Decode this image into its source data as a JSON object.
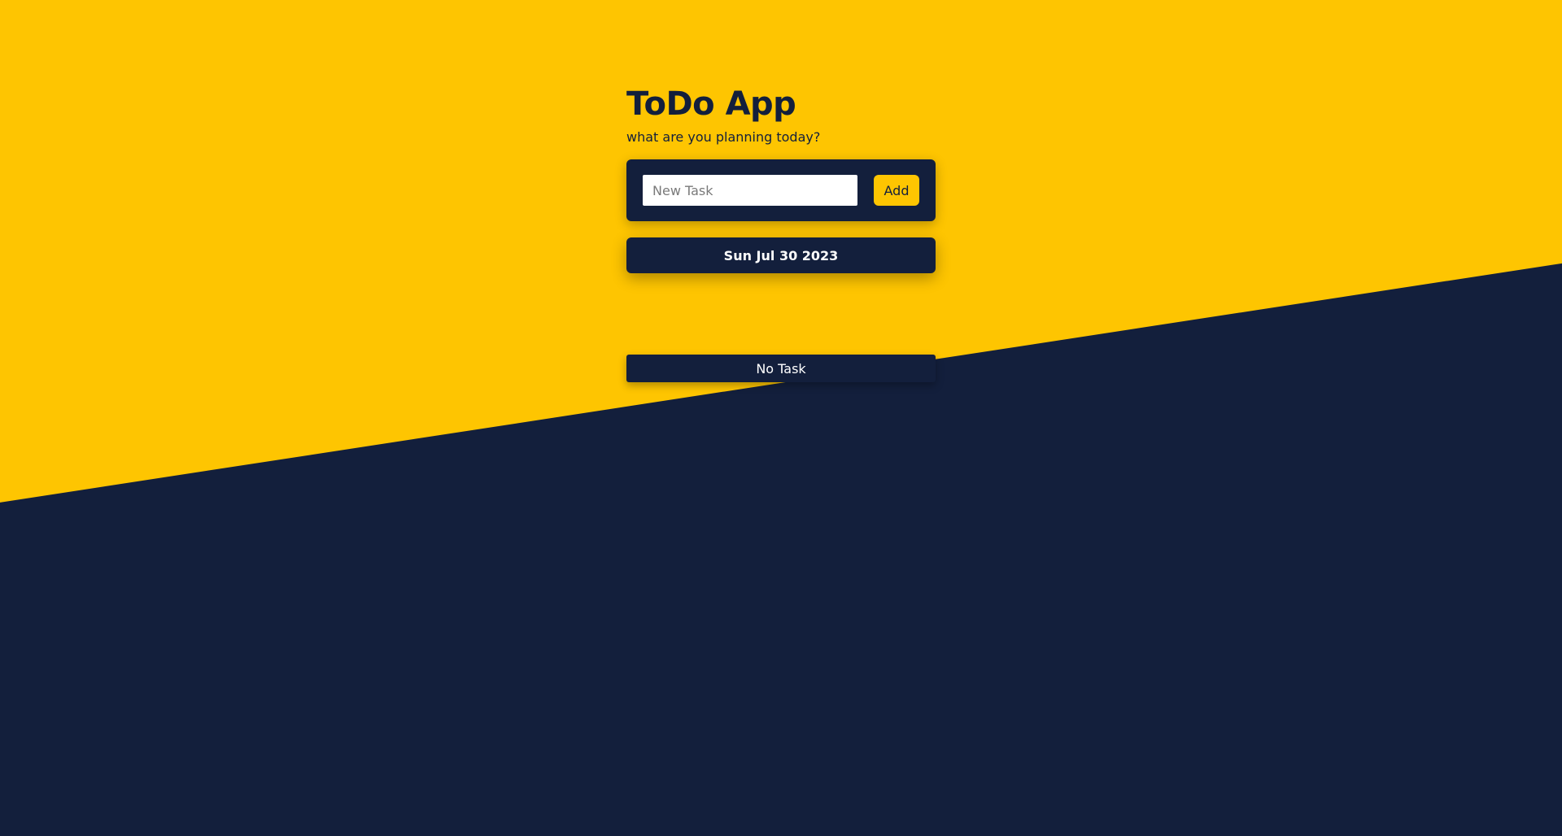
{
  "app": {
    "title": "ToDo App",
    "subtitle": "what are you planning today?"
  },
  "form": {
    "input_placeholder": "New Task",
    "input_value": "",
    "add_label": "Add"
  },
  "date": {
    "label": "Sun Jul 30 2023"
  },
  "tasks": {
    "empty_label": "No Task",
    "items": []
  },
  "colors": {
    "accent_yellow": "#fec501",
    "navy": "#131f3c",
    "white": "#ffffff"
  }
}
